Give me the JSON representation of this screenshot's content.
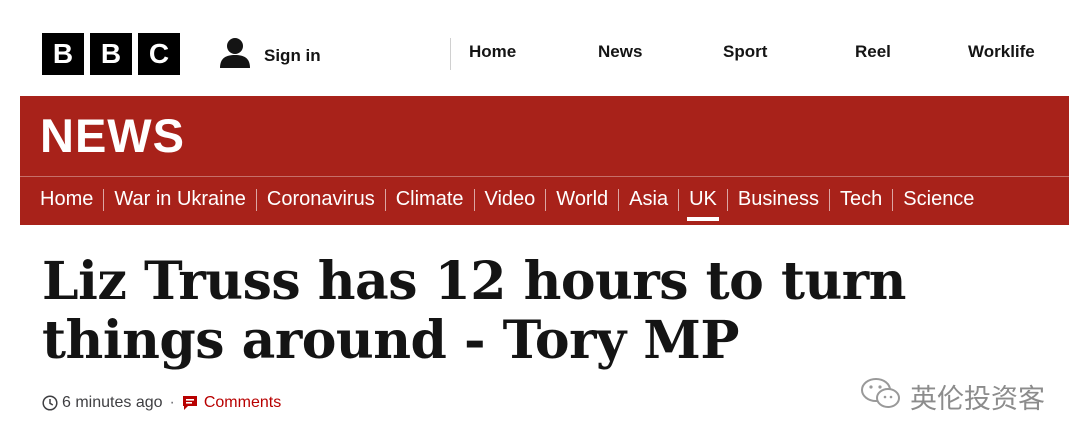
{
  "header": {
    "logo_letters": [
      "B",
      "B",
      "C"
    ],
    "signin_label": "Sign in",
    "nav": [
      "Home",
      "News",
      "Sport",
      "Reel",
      "Worklife"
    ]
  },
  "news": {
    "title": "NEWS",
    "subnav": [
      "Home",
      "War in Ukraine",
      "Coronavirus",
      "Climate",
      "Video",
      "World",
      "Asia",
      "UK",
      "Business",
      "Tech",
      "Science"
    ],
    "active_item": "UK"
  },
  "article": {
    "headline": "Liz Truss has 12 hours to turn things around - Tory MP",
    "timestamp": "6 minutes ago",
    "separator": "·",
    "comments_label": "Comments"
  },
  "watermark": {
    "text": "英伦投资客"
  },
  "colors": {
    "brand_red": "#a8221a",
    "link_red": "#b80000",
    "text": "#141414"
  }
}
